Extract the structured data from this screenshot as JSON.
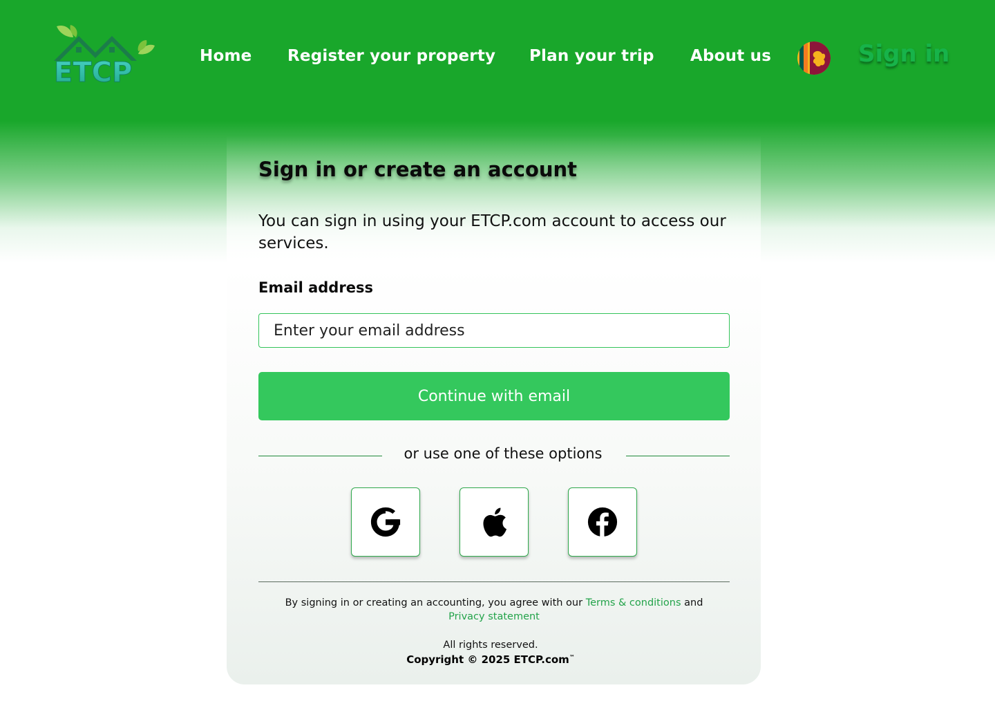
{
  "header": {
    "logo_text": "ETCP",
    "nav": [
      {
        "label": "Home"
      },
      {
        "label": "Register your property"
      },
      {
        "label": "Plan your trip"
      },
      {
        "label": "About us"
      }
    ],
    "signin_label": "Sign in"
  },
  "card": {
    "title": "Sign in or create an account",
    "description": "You can sign in using your ETCP.com account to access our services.",
    "email_label": "Email address",
    "email_placeholder": "Enter your email address",
    "email_value": "",
    "continue_label": "Continue with email",
    "divider_text": "or use one of these options",
    "social": [
      {
        "icon": "google-icon"
      },
      {
        "icon": "apple-icon"
      },
      {
        "icon": "facebook-icon"
      }
    ]
  },
  "footer": {
    "terms_prefix": "By signing in or creating an accounting, you agree with our",
    "terms_link": "Terms & conditions",
    "terms_and": "and",
    "privacy_link": "Privacy statement",
    "rights": "All rights reserved.",
    "copyright": "Copyright © 2025 ETCP.com",
    "trademark": "™"
  },
  "colors": {
    "header_green": "#19a72b",
    "button_green": "#34c85d",
    "link_green": "#23a34a"
  }
}
